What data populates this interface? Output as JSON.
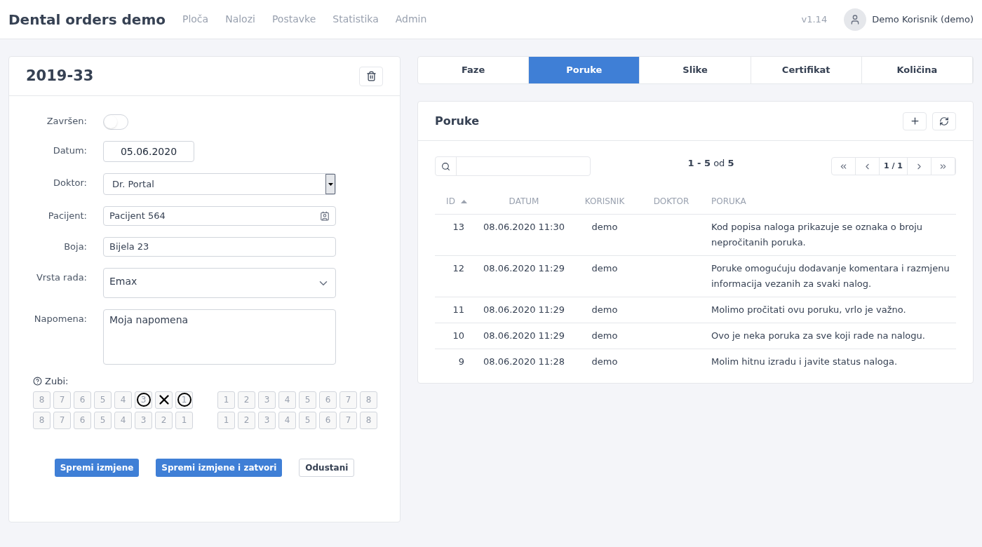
{
  "app": {
    "title": "Dental orders demo",
    "nav": [
      {
        "label": "Ploča"
      },
      {
        "label": "Nalozi"
      },
      {
        "label": "Postavke"
      },
      {
        "label": "Statistika"
      },
      {
        "label": "Admin"
      }
    ],
    "version": "v1.14",
    "user": "Demo Korisnik (demo)"
  },
  "order": {
    "title": "2019-33",
    "fields": [
      {
        "kind": "toggle",
        "label": "Završen:",
        "on": false
      },
      {
        "kind": "date",
        "label": "Datum:",
        "value": "05.06.2020"
      },
      {
        "kind": "combo",
        "label": "Doktor:",
        "value": "Dr. Portal"
      },
      {
        "kind": "lookup",
        "label": "Pacijent:",
        "value": "Pacijent 564"
      },
      {
        "kind": "text",
        "label": "Boja:",
        "value": "Bijela 23"
      },
      {
        "kind": "select",
        "label": "Vrsta rada:",
        "value": "Emax"
      },
      {
        "kind": "textarea",
        "label": "Napomena:",
        "value": "Moja napomena"
      }
    ],
    "teeth_label": "Zubi:",
    "teeth": [
      [
        [
          {
            "label": "8",
            "circled": false,
            "crossed": false
          },
          {
            "label": "7",
            "circled": false,
            "crossed": false
          },
          {
            "label": "6",
            "circled": false,
            "crossed": false
          },
          {
            "label": "5",
            "circled": false,
            "crossed": false
          },
          {
            "label": "4",
            "circled": false,
            "crossed": false
          },
          {
            "label": "3",
            "circled": true,
            "crossed": false
          },
          {
            "circled": false,
            "crossed": true
          },
          {
            "label": "1",
            "circled": true,
            "crossed": false
          }
        ],
        [
          {
            "label": "1",
            "circled": false,
            "crossed": false
          },
          {
            "label": "2",
            "circled": false,
            "crossed": false
          },
          {
            "label": "3",
            "circled": false,
            "crossed": false
          },
          {
            "label": "4",
            "circled": false,
            "crossed": false
          },
          {
            "label": "5",
            "circled": false,
            "crossed": false
          },
          {
            "label": "6",
            "circled": false,
            "crossed": false
          },
          {
            "label": "7",
            "circled": false,
            "crossed": false
          },
          {
            "label": "8",
            "circled": false,
            "crossed": false
          }
        ]
      ],
      [
        [
          {
            "label": "8",
            "circled": false,
            "crossed": false
          },
          {
            "label": "7",
            "circled": false,
            "crossed": false
          },
          {
            "label": "6",
            "circled": false,
            "crossed": false
          },
          {
            "label": "5",
            "circled": false,
            "crossed": false
          },
          {
            "label": "4",
            "circled": false,
            "crossed": false
          },
          {
            "label": "3",
            "circled": false,
            "crossed": false
          },
          {
            "label": "2",
            "circled": false,
            "crossed": false
          },
          {
            "label": "1",
            "circled": false,
            "crossed": false
          }
        ],
        [
          {
            "label": "1",
            "circled": false,
            "crossed": false
          },
          {
            "label": "2",
            "circled": false,
            "crossed": false
          },
          {
            "label": "3",
            "circled": false,
            "crossed": false
          },
          {
            "label": "4",
            "circled": false,
            "crossed": false
          },
          {
            "label": "5",
            "circled": false,
            "crossed": false
          },
          {
            "label": "6",
            "circled": false,
            "crossed": false
          },
          {
            "label": "7",
            "circled": false,
            "crossed": false
          },
          {
            "label": "8",
            "circled": false,
            "crossed": false
          }
        ]
      ]
    ],
    "buttons": [
      {
        "label": "Spremi izmjene",
        "kind": "primary"
      },
      {
        "label": "Spremi izmjene i zatvori",
        "kind": "primary"
      },
      {
        "label": "Odustani",
        "kind": "secondary"
      }
    ]
  },
  "tabs": [
    {
      "label": "Faze",
      "selected": false
    },
    {
      "label": "Poruke",
      "selected": true
    },
    {
      "label": "Slike",
      "selected": false
    },
    {
      "label": "Certifikat",
      "selected": false
    },
    {
      "label": "Količina",
      "selected": false
    }
  ],
  "messages": {
    "title": "Poruke",
    "range": "**1 - 5** od **5**",
    "page": "1 / 1",
    "columns": [
      "ID",
      "DATUM",
      "KORISNIK",
      "DOKTOR",
      "PORUKA"
    ],
    "rows": [
      [
        "13",
        "08.06.2020 11:30",
        "demo",
        "",
        "Kod popisa naloga prikazuje se oznaka o broju nepročitanih poruka."
      ],
      [
        "12",
        "08.06.2020 11:29",
        "demo",
        "",
        "Poruke omogućuju dodavanje komentara i razmjenu informacija vezanih za svaki nalog."
      ],
      [
        "11",
        "08.06.2020 11:29",
        "demo",
        "",
        "Molimo pročitati ovu poruku, vrlo je važno."
      ],
      [
        "10",
        "08.06.2020 11:29",
        "demo",
        "",
        "Ovo je neka poruka za sve koji rade na nalogu."
      ],
      [
        "9",
        "08.06.2020 11:28",
        "demo",
        "",
        "Molim hitnu izradu i javite status naloga."
      ]
    ]
  }
}
